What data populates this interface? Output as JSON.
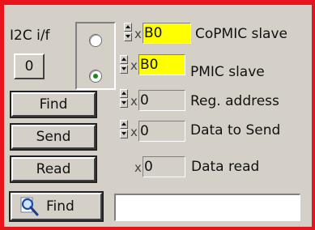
{
  "i2c_label": "I2C i/f",
  "i2c_index": "0",
  "slave_select": {
    "options": [
      "CoPMIC slave",
      "PMIC slave"
    ],
    "selected": "PMIC slave"
  },
  "fields": {
    "copmic_slave": {
      "prefix": "x",
      "value": "B0",
      "label": "CoPMIC slave"
    },
    "pmic_slave": {
      "prefix": "x",
      "value": "B0",
      "label": "PMIC slave"
    },
    "reg_address": {
      "prefix": "x",
      "value": "0",
      "label": "Reg. address"
    },
    "data_to_send": {
      "prefix": "x",
      "value": "0",
      "label": "Data to Send"
    },
    "data_read": {
      "prefix": "x",
      "value": "0",
      "label": "Data read"
    }
  },
  "buttons": {
    "find": "Find",
    "send": "Send",
    "read": "Read",
    "search_find": "Find"
  },
  "search": {
    "value": ""
  },
  "colors": {
    "border": "#e8141b",
    "highlight": "#ffff00",
    "panel": "#d4d0c8",
    "radio_dot": "#1a8a1a"
  },
  "icons": {
    "search_button": "magnifier-icon"
  }
}
